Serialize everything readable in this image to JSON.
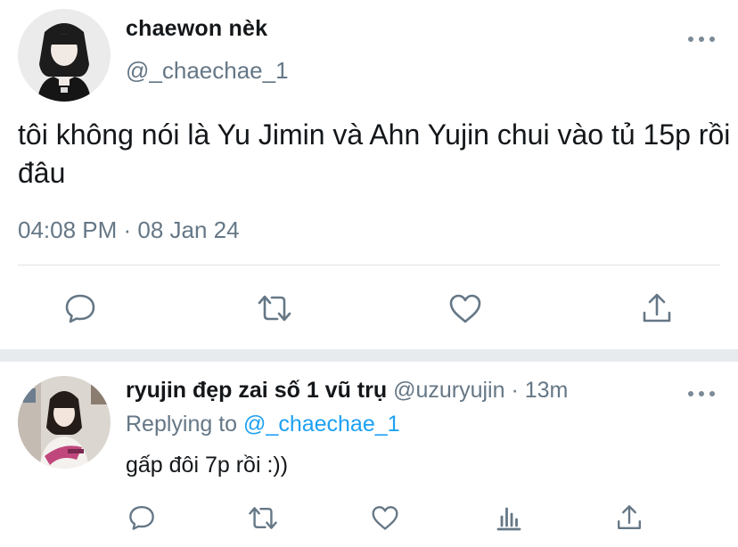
{
  "tweet": {
    "display_name": "chaewon nèk",
    "handle": "@_chaechae_1",
    "text": "tôi không nói là Yu Jimin và Ahn Yujin chui vào tủ 15p rồi đâu",
    "timestamp": "04:08 PM · 08 Jan 24",
    "more_icon": "more-dots-icon",
    "actions": [
      "reply-icon",
      "retweet-icon",
      "like-icon",
      "share-icon"
    ]
  },
  "reply": {
    "display_name": "ryujin đẹp zai số 1 vũ trụ",
    "handle": "@uzuryujin · 13m",
    "replying_prefix": "Replying to",
    "replying_mention": "@_chaechae_1",
    "text": "gấp đôi 7p rồi :))",
    "more_icon": "more-dots-icon",
    "actions": [
      "reply-icon",
      "retweet-icon",
      "like-icon",
      "analytics-icon",
      "share-icon"
    ]
  },
  "colors": {
    "primary_text": "#14171a",
    "secondary_text": "#657786",
    "link": "#1da1f2",
    "icon": "#657786",
    "divider": "#dfe3e7",
    "separator_band": "#e8ebee"
  }
}
